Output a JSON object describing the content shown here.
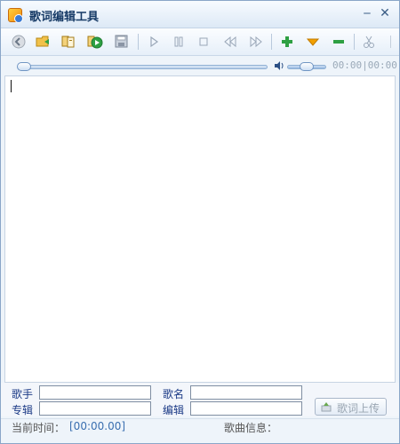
{
  "window": {
    "title": "歌词编辑工具"
  },
  "titlebar": {
    "minimize": "‒",
    "close": "✕"
  },
  "toolbar": {
    "tools": [
      {
        "name": "back-icon"
      },
      {
        "name": "open-folder-icon"
      },
      {
        "name": "copy-icon"
      },
      {
        "name": "play-green-icon"
      },
      {
        "name": "save-icon"
      },
      {
        "name": "play-icon"
      },
      {
        "name": "pause-icon"
      },
      {
        "name": "stop-icon"
      },
      {
        "name": "rewind-icon"
      },
      {
        "name": "fast-forward-icon"
      },
      {
        "name": "add-icon"
      },
      {
        "name": "down-arrow-icon"
      },
      {
        "name": "remove-icon"
      },
      {
        "name": "cut-icon"
      }
    ]
  },
  "player": {
    "time": "00:00|00:00"
  },
  "form": {
    "singer_label": "歌手",
    "album_label": "专辑",
    "title_label": "歌名",
    "editor_label": "编辑",
    "singer_value": "",
    "album_value": "",
    "title_value": "",
    "editor_value": "",
    "upload_label": "歌词上传"
  },
  "status": {
    "current_time_label": "当前时间：",
    "current_time_value": "[00:00.00]",
    "song_info_label": "歌曲信息："
  },
  "colors": {
    "accent": "#1b3a86",
    "time_blue": "#3a6fb0",
    "toolbar_green": "#2ea043",
    "toolbar_orange": "#f2a000"
  }
}
